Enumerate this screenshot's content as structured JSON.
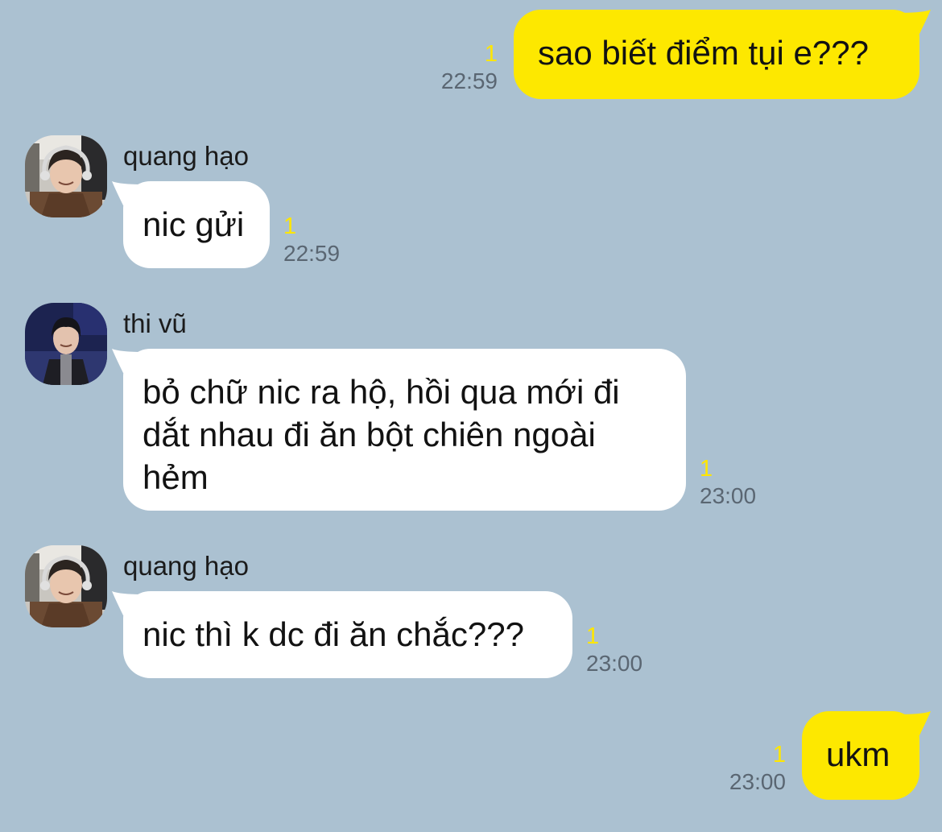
{
  "colors": {
    "background": "#abc1d1",
    "incoming_bubble": "#ffffff",
    "outgoing_bubble": "#fde800",
    "unread_indicator": "#ffe600",
    "timestamp": "#5a6672"
  },
  "messages": [
    {
      "direction": "outgoing",
      "text": "sao biết điểm tụi e???",
      "unread": "1",
      "time": "22:59"
    },
    {
      "direction": "incoming",
      "sender": "quang hạo",
      "avatar": "avatar-photo-quang-hao",
      "text": "nic gửi",
      "unread": "1",
      "time": "22:59"
    },
    {
      "direction": "incoming",
      "sender": "thi vũ",
      "avatar": "avatar-photo-thi-vu",
      "text": "bỏ chữ nic ra hộ, hồi qua mới đi dắt nhau đi ăn bột chiên ngoài hẻm",
      "unread": "1",
      "time": "23:00"
    },
    {
      "direction": "incoming",
      "sender": "quang hạo",
      "avatar": "avatar-photo-quang-hao",
      "text": "nic thì k dc đi ăn chắc???",
      "unread": "1",
      "time": "23:00"
    },
    {
      "direction": "outgoing",
      "text": "ukm",
      "unread": "1",
      "time": "23:00"
    }
  ]
}
